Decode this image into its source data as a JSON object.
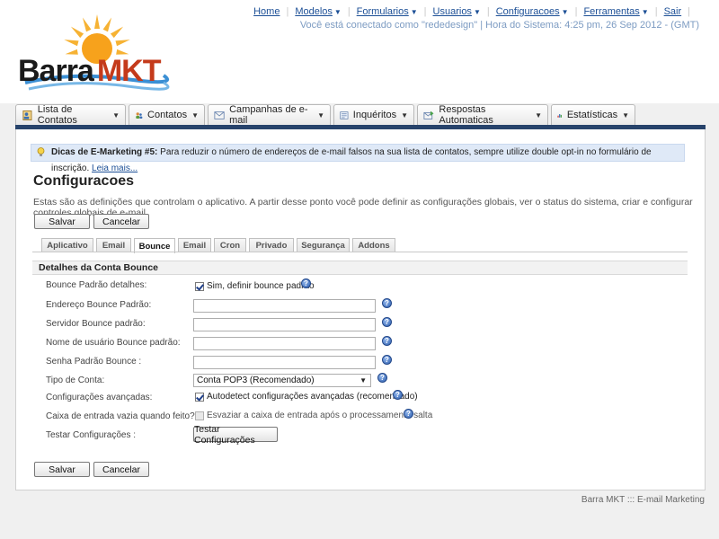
{
  "brand": {
    "part1": "Barra",
    "part2": "MKT"
  },
  "topnav": [
    {
      "label": "Home",
      "dropdown": false
    },
    {
      "label": "Modelos",
      "dropdown": true
    },
    {
      "label": "Formularios",
      "dropdown": true
    },
    {
      "label": "Usuarios",
      "dropdown": true
    },
    {
      "label": "Configuracoes",
      "dropdown": true
    },
    {
      "label": "Ferramentas",
      "dropdown": true
    },
    {
      "label": "Sair",
      "dropdown": false
    }
  ],
  "userline": "Você está conectado como \"rededesign\" | Hora do Sistema: 4:25 pm, 26 Sep 2012 - (GMT)",
  "mainnav": [
    {
      "label": "Lista de Contatos",
      "icon": "contact-list-icon"
    },
    {
      "label": "Contatos",
      "icon": "contacts-icon"
    },
    {
      "label": "Campanhas de e-mail",
      "icon": "envelope-icon"
    },
    {
      "label": "Inquéritos",
      "icon": "survey-icon"
    },
    {
      "label": "Respostas Automaticas",
      "icon": "autoresponder-icon"
    },
    {
      "label": "Estatísticas",
      "icon": "chart-icon"
    }
  ],
  "tip": {
    "bold": "Dicas de E-Marketing #5:",
    "text": " Para reduzir o número de endereços de e-mail falsos na sua lista de contatos, sempre utilize double opt-in no formulário de inscrição. ",
    "link": "Leia mais..."
  },
  "page": {
    "title": "Configuracoes",
    "description": "Estas são as definições que controlam o aplicativo. A partir desse ponto você pode definir as configurações globais, ver o status do sistema, criar e configurar controles globais de e-mail."
  },
  "buttons": {
    "save": "Salvar",
    "cancel": "Cancelar",
    "test": "Testar Configurações"
  },
  "subtabs": [
    "Aplicativo",
    "Email",
    "Bounce",
    "Email",
    "Cron",
    "Privado",
    "Segurança",
    "Addons"
  ],
  "active_subtab": "Bounce",
  "section_title": "Detalhes da Conta Bounce",
  "fields": {
    "bounce_default_label": "Bounce Padrão detalhes:",
    "bounce_default_checkbox": "Sim, definir bounce padrão",
    "bounce_address_label": "Endereço Bounce Padrão:",
    "bounce_address_value": "",
    "bounce_server_label": "Servidor Bounce padrão:",
    "bounce_server_value": "",
    "bounce_username_label": "Nome de usuário Bounce padrão:",
    "bounce_username_value": "",
    "bounce_password_label": "Senha Padrão Bounce :",
    "bounce_password_value": "",
    "account_type_label": "Tipo de Conta:",
    "account_type_value": "Conta POP3 (Recomendado)",
    "advanced_label": "Configurações avançadas:",
    "advanced_checkbox": "Autodetect configurações avançadas (recomendado)",
    "empty_inbox_label": "Caixa de entrada vazia quando feito?",
    "empty_inbox_checkbox": "Esvaziar a caixa de entrada após o processamento salta",
    "test_label": "Testar Configurações :"
  },
  "footer": "Barra MKT ::: E-mail Marketing",
  "colors": {
    "navbar": "#27436b",
    "link": "#1c4f96",
    "brand_red": "#c43a1b",
    "tip_bg": "#dfe9f7"
  }
}
